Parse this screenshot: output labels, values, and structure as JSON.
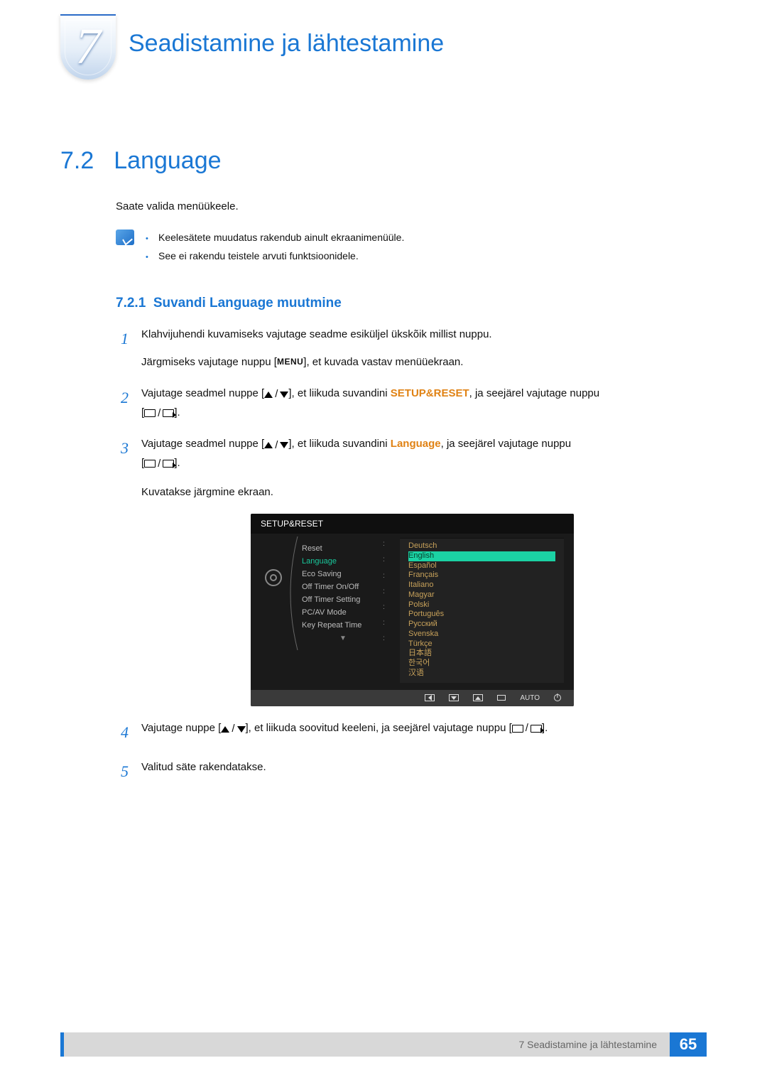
{
  "chapter": {
    "number": "7",
    "title": "Seadistamine ja lähtestamine"
  },
  "section": {
    "number": "7.2",
    "title": "Language"
  },
  "intro": "Saate valida menüükeele.",
  "notes": [
    "Keelesätete muudatus rakendub ainult ekraanimenüüle.",
    "See ei rakendu teistele arvuti funktsioonidele."
  ],
  "subsection": {
    "number": "7.2.1",
    "title": "Suvandi Language muutmine"
  },
  "steps": {
    "s1": {
      "n": "1",
      "text_a": "Klahvijuhendi kuvamiseks vajutage seadme esiküljel ükskõik millist nuppu.",
      "text_b1": "Järgmiseks vajutage nuppu [",
      "menu": "MENU",
      "text_b2": "], et kuvada vastav menüüekraan."
    },
    "s2": {
      "n": "2",
      "text_a": "Vajutage seadmel nuppe [",
      "text_b": "], et liikuda suvandini ",
      "kw": "SETUP&RESET",
      "text_c": ", ja seejärel vajutage nuppu"
    },
    "s3": {
      "n": "3",
      "text_a": "Vajutage seadmel nuppe [",
      "text_b": "], et liikuda suvandini ",
      "kw": "Language",
      "text_c": ", ja seejärel vajutage nuppu",
      "text_d": "Kuvatakse järgmine ekraan."
    },
    "s4": {
      "n": "4",
      "text_a": "Vajutage nuppe [",
      "text_b": "], et liikuda soovitud keeleni, ja seejärel vajutage nuppu [",
      "text_c": "]."
    },
    "s5": {
      "n": "5",
      "text": "Valitud säte rakendatakse."
    }
  },
  "osd": {
    "title": "SETUP&RESET",
    "menu_items": [
      "Reset",
      "Language",
      "Eco Saving",
      "Off Timer On/Off",
      "Off Timer Setting",
      "PC/AV Mode",
      "Key Repeat Time"
    ],
    "active_index": 1,
    "languages": [
      "Deutsch",
      "English",
      "Español",
      "Français",
      "Italiano",
      "Magyar",
      "Polski",
      "Português",
      "Русский",
      "Svenska",
      "Türkçe",
      "日本語",
      "한국어",
      "汉语"
    ],
    "selected_lang_index": 1,
    "footer_auto": "AUTO"
  },
  "footer": {
    "text": "7 Seadistamine ja lähtestamine",
    "page": "65"
  }
}
